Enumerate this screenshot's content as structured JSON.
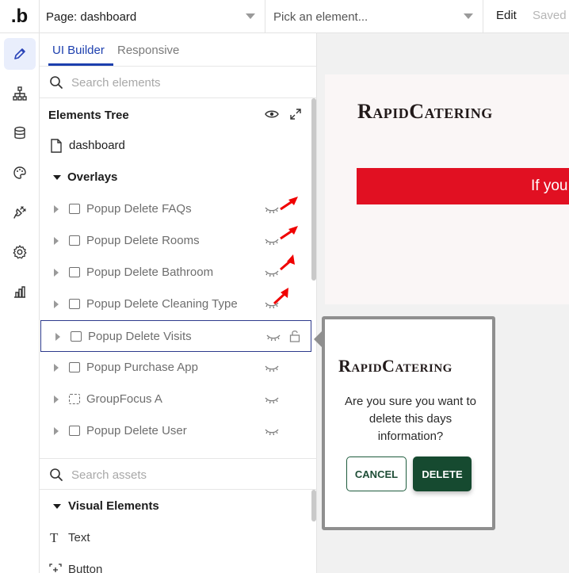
{
  "topbar": {
    "logo": ".b",
    "page_select": "Page: dashboard",
    "element_picker_placeholder": "Pick an element...",
    "edit_label": "Edit",
    "saved_label": "Saved"
  },
  "rail": {
    "items": [
      "pencil-icon",
      "sitemap-icon",
      "database-icon",
      "palette-icon",
      "plug-icon",
      "settings-icon",
      "chart-icon"
    ]
  },
  "panel": {
    "tabs": [
      "UI Builder",
      "Responsive"
    ],
    "search_elements_placeholder": "Search elements",
    "elements_tree_title": "Elements Tree",
    "page_name": "dashboard",
    "overlays_label": "Overlays",
    "overlay_items": [
      "Popup Delete FAQs",
      "Popup Delete Rooms",
      "Popup Delete Bathroom",
      "Popup Delete Cleaning Type",
      "Popup Delete Visits",
      "Popup Purchase App",
      "GroupFocus A",
      "Popup Delete User"
    ],
    "search_assets_placeholder": "Search assets",
    "visual_elements_label": "Visual Elements",
    "visual_items": [
      "Text",
      "Button"
    ]
  },
  "canvas": {
    "brand": "RapidCatering",
    "banner_text": "If you",
    "banner_color": "#e11022"
  },
  "popup": {
    "brand": "RapidCatering",
    "message": "Are you sure you want to delete this days information?",
    "cancel_label": "CANCEL",
    "delete_label": "DELETE",
    "delete_color": "#164a30"
  }
}
